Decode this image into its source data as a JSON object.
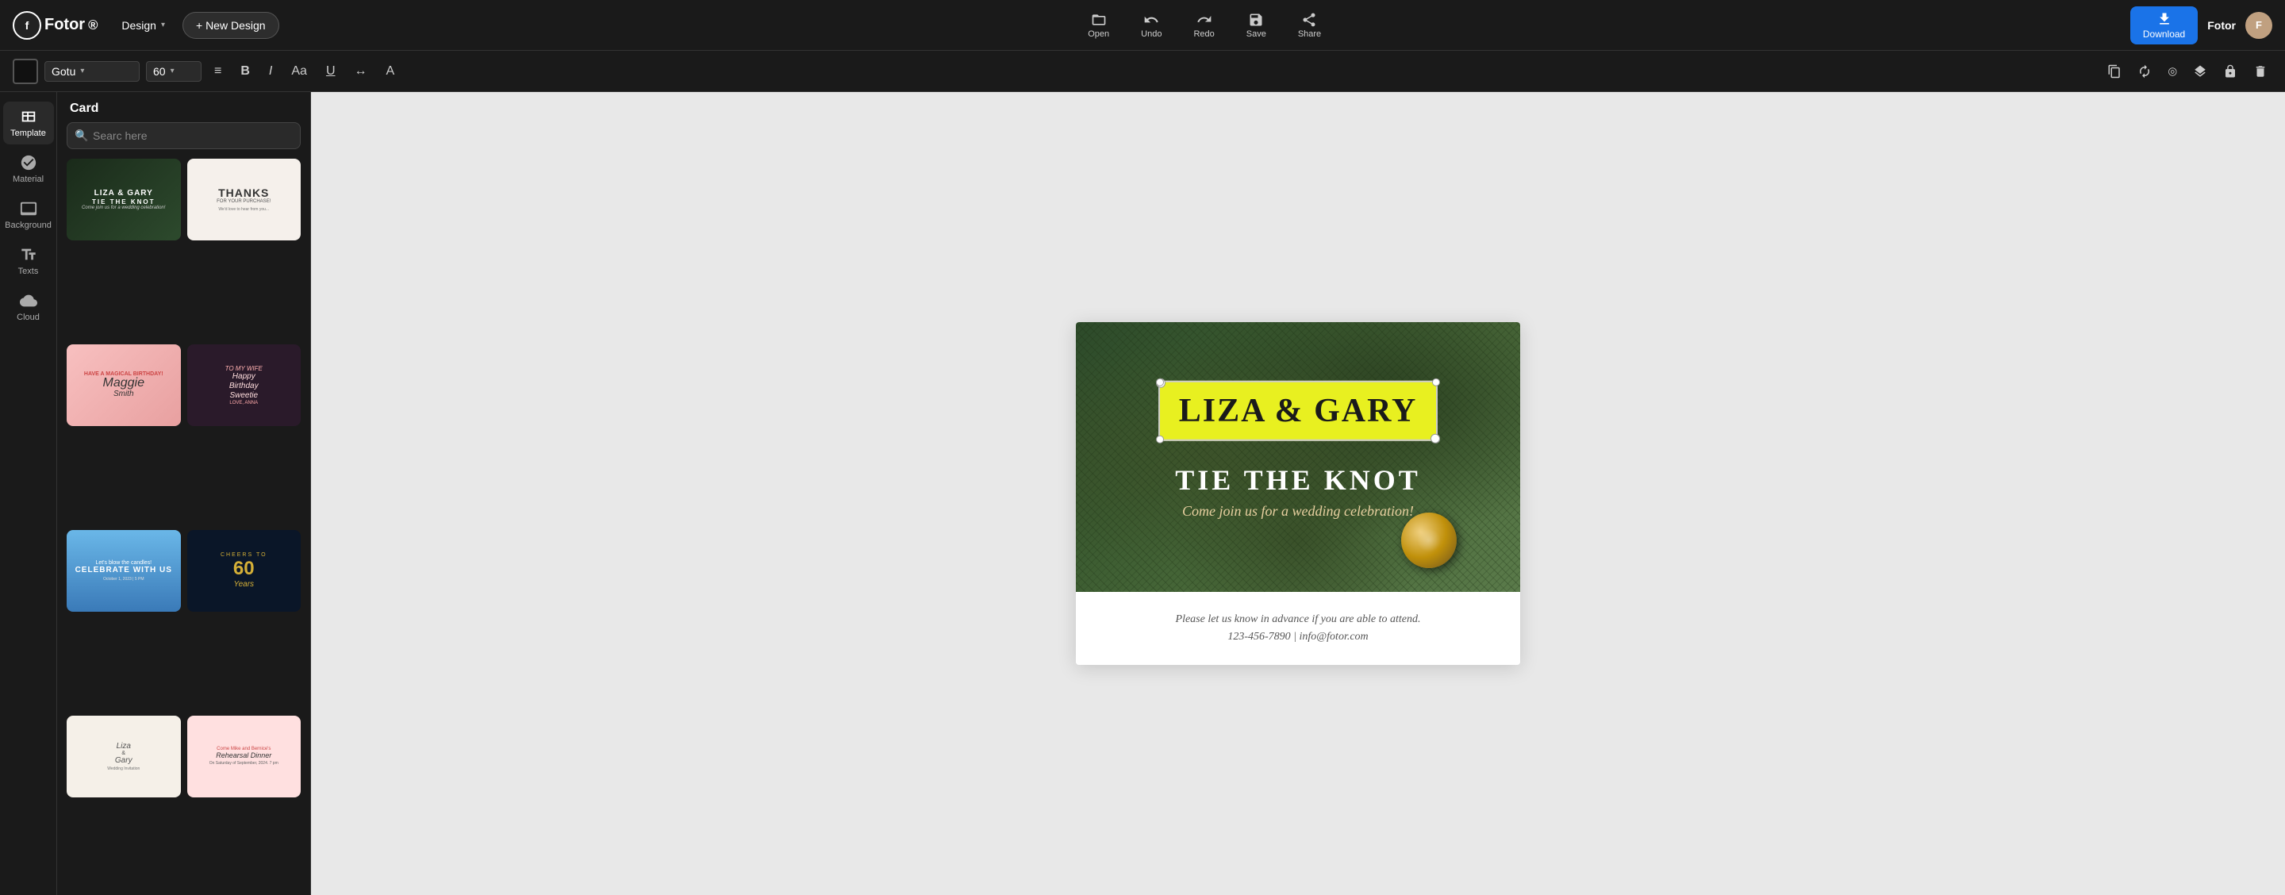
{
  "app": {
    "logo": "fotor",
    "logo_text": "Fotor",
    "superscript": "®"
  },
  "topbar": {
    "design_label": "Design",
    "new_design_label": "+ New Design",
    "open_label": "Open",
    "undo_label": "Undo",
    "redo_label": "Redo",
    "save_label": "Save",
    "share_label": "Share",
    "download_label": "Download",
    "user_name": "Fotor"
  },
  "toolbar": {
    "font_name": "Gotu",
    "font_size": "60",
    "align_icon": "align",
    "bold_label": "B",
    "italic_label": "I",
    "size_aa_label": "Aa",
    "underline_label": "U",
    "spacing_label": "↔",
    "color_label": "A"
  },
  "sidebar": {
    "items": [
      {
        "id": "template",
        "label": "Template",
        "icon": "template-icon"
      },
      {
        "id": "material",
        "label": "Material",
        "icon": "material-icon"
      },
      {
        "id": "background",
        "label": "Background",
        "icon": "background-icon"
      },
      {
        "id": "texts",
        "label": "Texts",
        "icon": "texts-icon"
      },
      {
        "id": "cloud",
        "label": "Cloud",
        "icon": "cloud-icon"
      }
    ],
    "active": "template"
  },
  "panel": {
    "title": "Card",
    "search_placeholder": "Searc here",
    "templates": [
      {
        "id": "liza-gary",
        "label": "Liza & Gary Tie the Knot"
      },
      {
        "id": "thanks",
        "label": "Thanks for your purchase"
      },
      {
        "id": "birthday-maggie",
        "label": "Birthday - Maggie Smith"
      },
      {
        "id": "happy-birthday-sweetie",
        "label": "Happy Birthday Sweetie"
      },
      {
        "id": "celebrate-with-us",
        "label": "Celebrate With Us"
      },
      {
        "id": "60-years",
        "label": "60 Years"
      },
      {
        "id": "liza-gary-2",
        "label": "Liza & Gary Wedding"
      },
      {
        "id": "rehearsal-dinner",
        "label": "Rehearsal Dinner"
      }
    ]
  },
  "canvas": {
    "card": {
      "name_box_text": "LIZA & GARY",
      "knot_text": "TIE THE KNOT",
      "tagline": "Come join us for a wedding celebration!",
      "footer_line1": "Please let us know in advance if you are able to attend.",
      "footer_line2": "123-456-7890 | info@fotor.com"
    }
  }
}
